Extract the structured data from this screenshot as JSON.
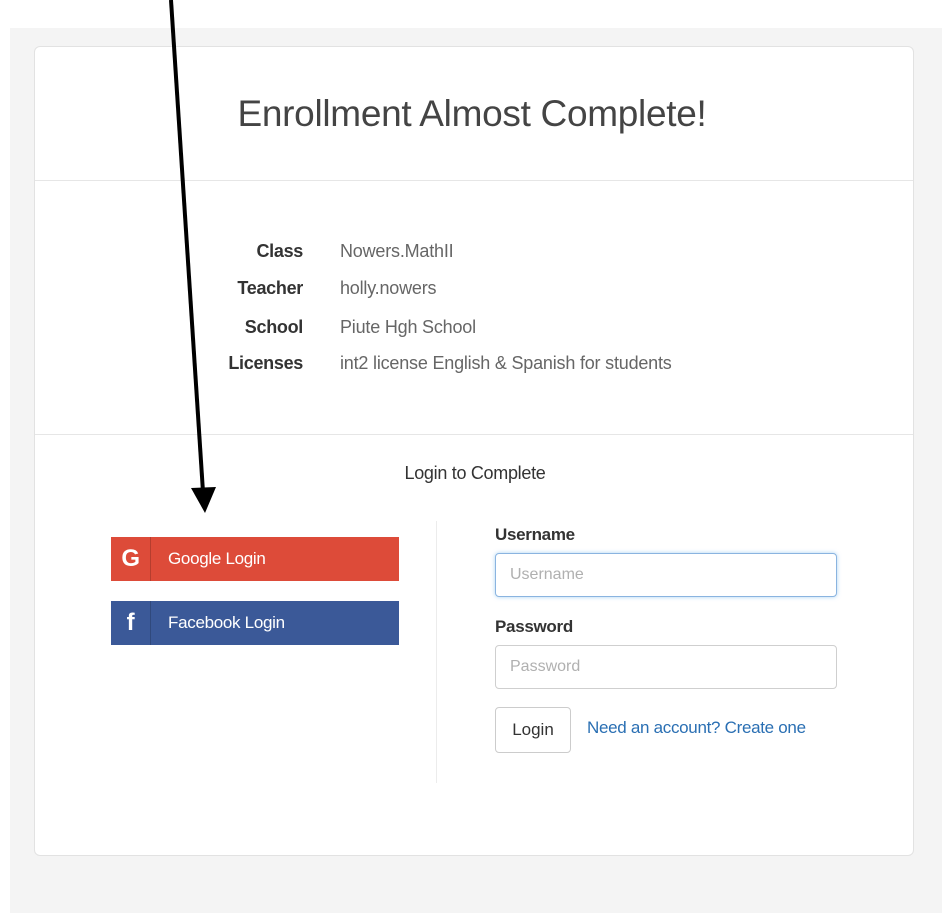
{
  "card": {
    "title": "Enrollment Almost Complete!"
  },
  "details": [
    {
      "label": "Class",
      "value": "Nowers.MathII"
    },
    {
      "label": "Teacher",
      "value": "holly.nowers"
    },
    {
      "label": "School",
      "value": "Piute Hgh School"
    },
    {
      "label": "Licenses",
      "value": "int2 license English & Spanish for students"
    }
  ],
  "login": {
    "heading": "Login to Complete",
    "google": {
      "icon": "G",
      "label": "Google Login",
      "color": "#dd4b39"
    },
    "facebook": {
      "icon": "f",
      "label": "Facebook Login",
      "color": "#3b5998"
    },
    "username": {
      "label": "Username",
      "placeholder": "Username",
      "value": ""
    },
    "password": {
      "label": "Password",
      "placeholder": "Password",
      "value": ""
    },
    "submit_label": "Login",
    "create_account_link": "Need an account? Create one"
  },
  "colors": {
    "link": "#2a6fb3",
    "focus": "#8ab4e0"
  }
}
